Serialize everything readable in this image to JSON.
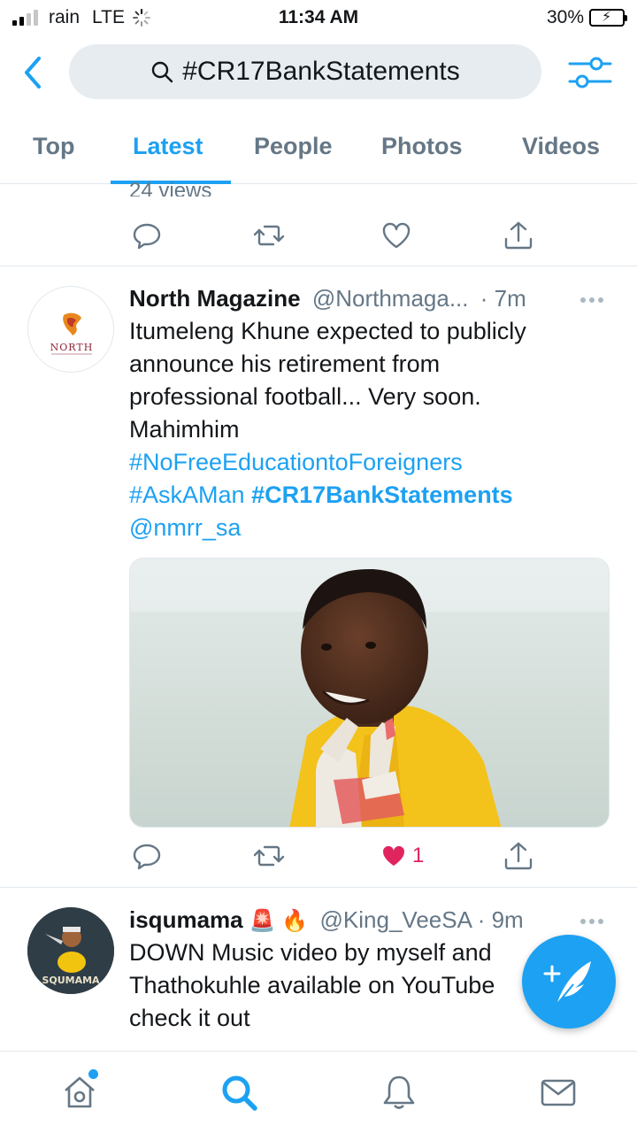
{
  "status_bar": {
    "carrier": "rain",
    "network": "LTE",
    "time": "11:34 AM",
    "battery_percent": "30%",
    "battery_level": 0.3,
    "signal_bars": 2
  },
  "search": {
    "query": "#CR17BankStatements"
  },
  "tabs": [
    {
      "label": "Top",
      "active": false
    },
    {
      "label": "Latest",
      "active": true
    },
    {
      "label": "People",
      "active": false
    },
    {
      "label": "Photos",
      "active": false
    },
    {
      "label": "Videos",
      "active": false
    }
  ],
  "previous_tweet": {
    "views": "24 views"
  },
  "tweets": [
    {
      "name": "North Magazine",
      "handle": "@Northmaga...",
      "time": "· 7m",
      "avatar_text": "NORTH",
      "text_plain": "Itumeleng Khune expected to publicly announce his retirement from professional football... Very soon. Mahimhim",
      "line1": "Itumeleng Khune expected to publicly",
      "line2": "announce his retirement from",
      "line3": "professional football... Very soon.",
      "line4": "Mahimhim",
      "hashtag1": "#NoFreeEducationtoForeigners",
      "hashtag2": "#AskAMan",
      "hashtag3": "#CR17BankStatements",
      "mention": "@nmrr_sa",
      "likes": "1",
      "liked": true
    },
    {
      "name": "isqumama",
      "emojis": "🚨 🔥",
      "handle": "@King_VeeSA",
      "time": "· 9m",
      "avatar_text": "SQUMAMA",
      "line1": "DOWN Music video by myself and",
      "line2": "Thathokuhle available on YouTube",
      "line3": "check it out"
    }
  ],
  "colors": {
    "accent": "#1da1f2",
    "secondary_text": "#657786",
    "like": "#e0245e",
    "divider": "#e1e8ed"
  },
  "icons": {
    "back": "chevron-left-icon",
    "search": "magnifier-icon",
    "filter": "sliders-icon",
    "reply": "reply-icon",
    "retweet": "retweet-icon",
    "like": "heart-icon",
    "share": "share-icon",
    "compose": "compose-feather-icon",
    "nav_home": "home-icon",
    "nav_search": "search-icon",
    "nav_notifications": "bell-icon",
    "nav_messages": "mail-icon"
  }
}
